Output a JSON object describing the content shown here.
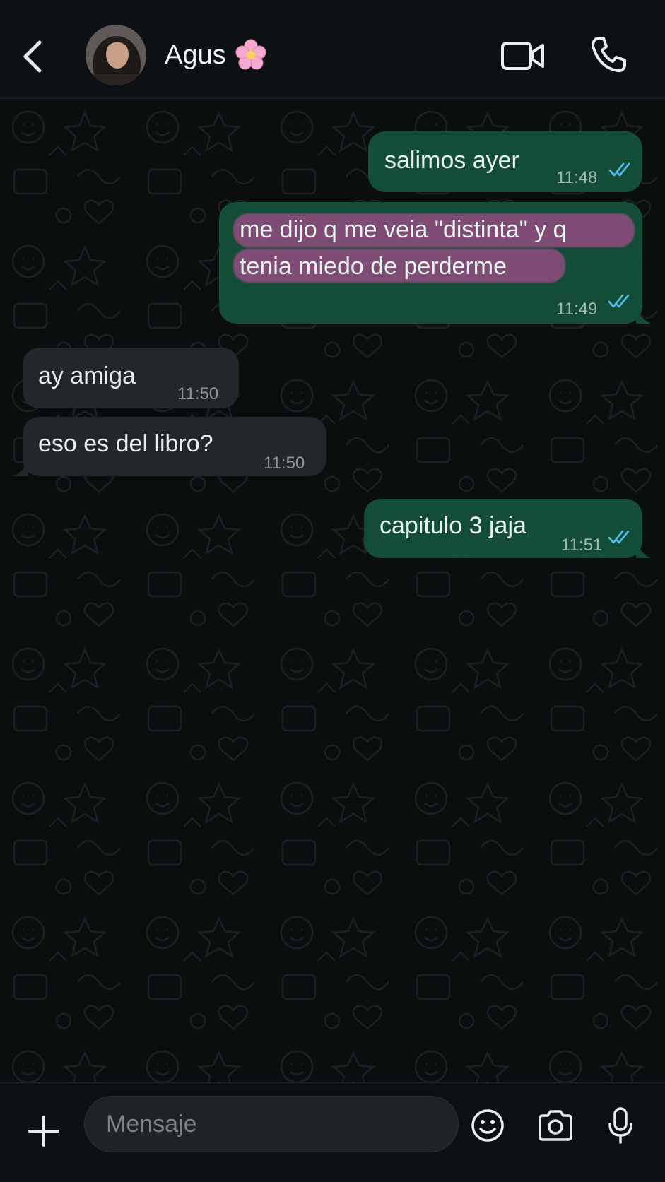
{
  "header": {
    "contact_name": "Agus",
    "icons": {
      "back": "chevron-left-icon",
      "avatar": "avatar",
      "name_emoji": "cherry-blossom-icon",
      "video": "video-camera-icon",
      "call": "phone-icon"
    }
  },
  "messages": [
    {
      "direction": "outgoing",
      "text": "salimos ayer",
      "time": "11:48",
      "status": "read"
    },
    {
      "direction": "outgoing",
      "text_lines": [
        "me dijo q me veia \"distinta\" y q",
        "tenia miedo de perderme"
      ],
      "time": "11:49",
      "status": "read",
      "highlighted": true,
      "highlight_color": "#d64da8"
    },
    {
      "direction": "incoming",
      "text": "ay amiga",
      "time": "11:50"
    },
    {
      "direction": "incoming",
      "text": "eso es del libro?",
      "time": "11:50"
    },
    {
      "direction": "outgoing",
      "text": "capitulo 3 jaja",
      "time": "11:51",
      "status": "read"
    }
  ],
  "composer": {
    "placeholder": "Mensaje",
    "value": "",
    "icons": {
      "add": "plus-icon",
      "emoji": "smiley-icon",
      "camera": "camera-icon",
      "mic": "microphone-icon"
    }
  },
  "colors": {
    "outgoing_bubble": "#144d37",
    "incoming_bubble": "#23272a",
    "read_ticks": "#53bdeb",
    "background": "#0b0e0f"
  }
}
